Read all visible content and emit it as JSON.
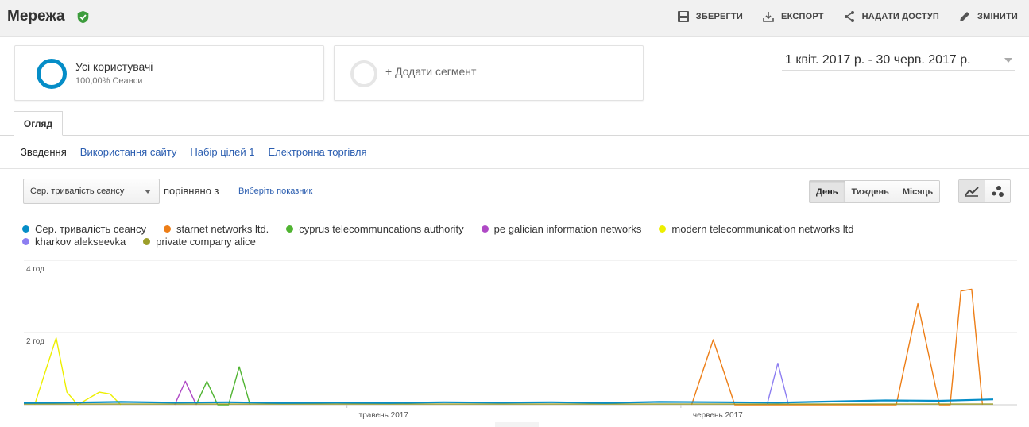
{
  "header": {
    "title": "Мережа",
    "actions": [
      {
        "label": "ЗБЕРЕГТИ",
        "icon": "save-icon"
      },
      {
        "label": "ЕКСПОРТ",
        "icon": "export-icon"
      },
      {
        "label": "НАДАТИ ДОСТУП",
        "icon": "share-icon"
      },
      {
        "label": "ЗМІНИТИ",
        "icon": "edit-icon"
      }
    ]
  },
  "segments": {
    "all_users": {
      "name": "Усі користувачі",
      "sub": "100,00% Сеанси"
    },
    "add_label": "+ Додати сегмент"
  },
  "date_range": "1 квіт. 2017 р. - 30 черв. 2017 р.",
  "tabs": {
    "overview": "Огляд"
  },
  "subnav": [
    "Зведення",
    "Використання сайту",
    "Набір цілей 1",
    "Електронна торгівля"
  ],
  "controls": {
    "metric": "Сер. тривалість сеансу",
    "compare_label": "порівняно з",
    "pick_metric": "Виберіть показник",
    "periods": [
      "День",
      "Тиждень",
      "Місяць"
    ],
    "active_period": "День"
  },
  "colors": {
    "accent": "#058dc7",
    "link": "#2a5db0"
  },
  "chart_data": {
    "type": "line",
    "x": [
      "2017-04-01",
      "2017-06-30"
    ],
    "x_tick_labels": [
      "травень 2017",
      "червень 2017"
    ],
    "y_tick_labels": [
      "4 год",
      "2 год"
    ],
    "ylim_hours": [
      0,
      4
    ],
    "grid": true,
    "legend_position": "top",
    "series": [
      {
        "name": "Сер. тривалість сеансу",
        "color": "#058dc7",
        "values": [
          [
            "2017-04-01",
            0.05
          ],
          [
            "2017-04-05",
            0.06
          ],
          [
            "2017-04-10",
            0.08
          ],
          [
            "2017-04-15",
            0.06
          ],
          [
            "2017-04-20",
            0.07
          ],
          [
            "2017-04-25",
            0.05
          ],
          [
            "2017-04-30",
            0.06
          ],
          [
            "2017-05-05",
            0.05
          ],
          [
            "2017-05-10",
            0.07
          ],
          [
            "2017-05-15",
            0.06
          ],
          [
            "2017-05-20",
            0.07
          ],
          [
            "2017-05-25",
            0.05
          ],
          [
            "2017-05-30",
            0.08
          ],
          [
            "2017-06-05",
            0.07
          ],
          [
            "2017-06-10",
            0.06
          ],
          [
            "2017-06-15",
            0.09
          ],
          [
            "2017-06-20",
            0.12
          ],
          [
            "2017-06-25",
            0.11
          ],
          [
            "2017-06-30",
            0.15
          ]
        ]
      },
      {
        "name": "starnet networks ltd.",
        "color": "#ed7e17",
        "values": [
          [
            "2017-06-02",
            0.0
          ],
          [
            "2017-06-04",
            1.8
          ],
          [
            "2017-06-06",
            0.0
          ],
          [
            "2017-06-21",
            0.0
          ],
          [
            "2017-06-23",
            2.8
          ],
          [
            "2017-06-25",
            0.0
          ],
          [
            "2017-06-26",
            0.0
          ],
          [
            "2017-06-27",
            3.15
          ],
          [
            "2017-06-28",
            3.2
          ],
          [
            "2017-06-29",
            0.0
          ]
        ]
      },
      {
        "name": "cyprus telecommuncations authority",
        "color": "#50b432",
        "values": [
          [
            "2017-04-17",
            0.0
          ],
          [
            "2017-04-18",
            0.65
          ],
          [
            "2017-04-19",
            0.0
          ],
          [
            "2017-04-20",
            0.0
          ],
          [
            "2017-04-21",
            1.05
          ],
          [
            "2017-04-22",
            0.0
          ]
        ]
      },
      {
        "name": "pe galician information networks",
        "color": "#af49c5",
        "values": [
          [
            "2017-04-15",
            0.0
          ],
          [
            "2017-04-16",
            0.65
          ],
          [
            "2017-04-17",
            0.0
          ]
        ]
      },
      {
        "name": "modern telecommunication networks ltd",
        "color": "#edef00",
        "values": [
          [
            "2017-04-02",
            0.0
          ],
          [
            "2017-04-04",
            1.85
          ],
          [
            "2017-04-05",
            0.35
          ],
          [
            "2017-04-06",
            0.0
          ],
          [
            "2017-04-08",
            0.35
          ],
          [
            "2017-04-09",
            0.3
          ],
          [
            "2017-04-10",
            0.0
          ]
        ]
      },
      {
        "name": "kharkov alekseevka",
        "color": "#8d7ef1",
        "values": [
          [
            "2017-06-09",
            0.0
          ],
          [
            "2017-06-10",
            1.15
          ],
          [
            "2017-06-11",
            0.0
          ]
        ]
      },
      {
        "name": "private company alice",
        "color": "#9c9e2a",
        "values": [
          [
            "2017-04-01",
            0.02
          ],
          [
            "2017-06-30",
            0.02
          ]
        ]
      }
    ]
  }
}
